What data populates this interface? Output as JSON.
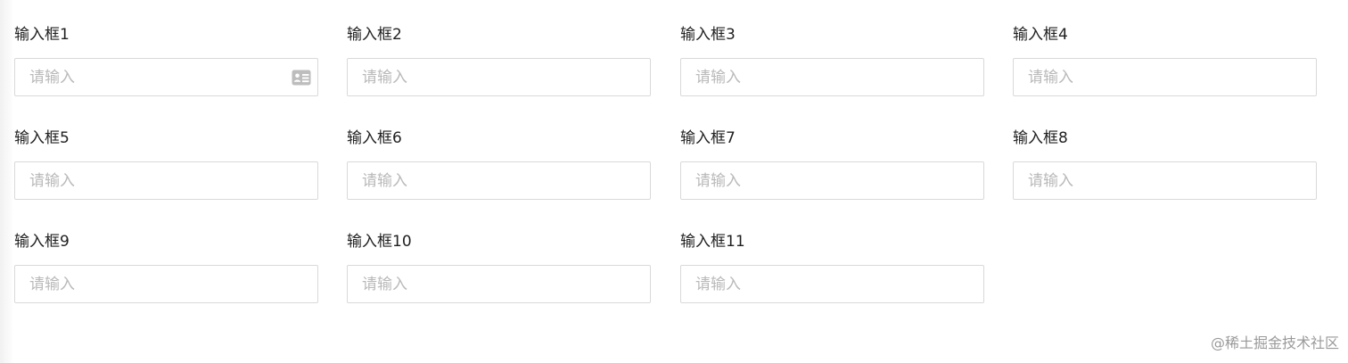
{
  "form": {
    "placeholder": "请输入",
    "fields": [
      {
        "label": "输入框1",
        "icon": "id-card-icon"
      },
      {
        "label": "输入框2"
      },
      {
        "label": "输入框3"
      },
      {
        "label": "输入框4"
      },
      {
        "label": "输入框5"
      },
      {
        "label": "输入框6"
      },
      {
        "label": "输入框7"
      },
      {
        "label": "输入框8"
      },
      {
        "label": "输入框9"
      },
      {
        "label": "输入框10"
      },
      {
        "label": "输入框11"
      }
    ]
  },
  "watermark": "@稀土掘金技术社区"
}
